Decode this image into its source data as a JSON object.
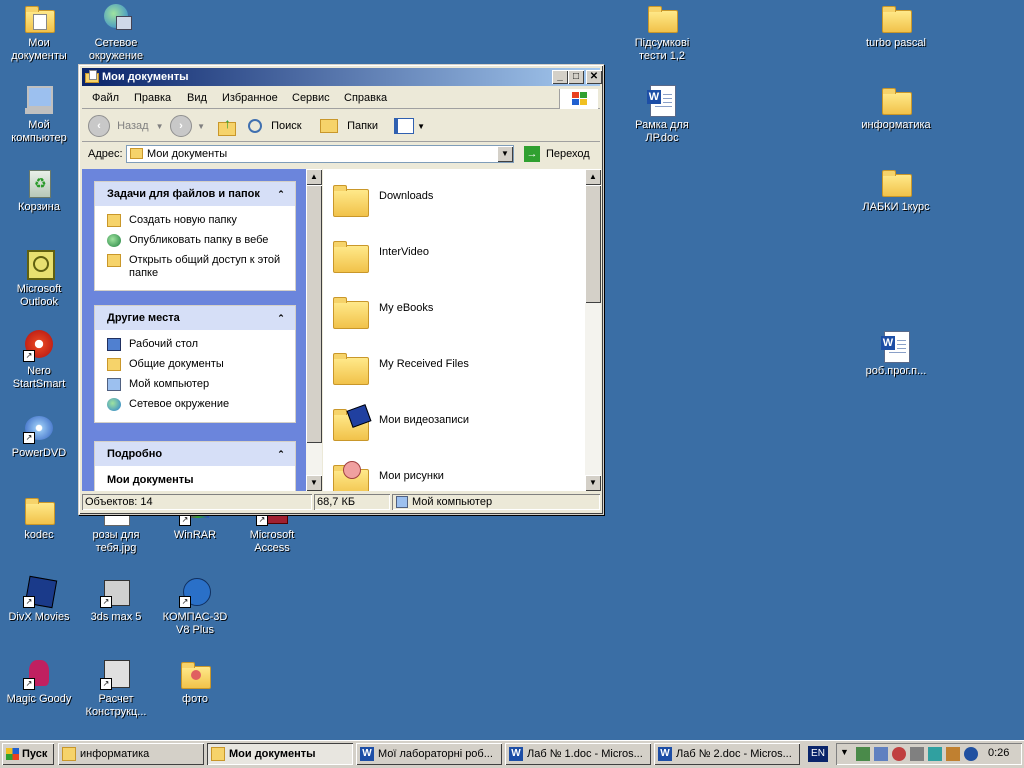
{
  "desktop": {
    "icons": {
      "my_documents": "Мои документы",
      "network": "Сетевое окружение",
      "my_computer": "Мой компьютер",
      "recycle_bin": "Корзина",
      "outlook": "Microsoft Outlook",
      "nero": "Nero StartSmart",
      "powerdvd": "PowerDVD",
      "kodec": "kodec",
      "roses": "розы для тебя.jpg",
      "winrar": "WinRAR",
      "access": "Microsoft Access",
      "divx": "DivX Movies",
      "max": "3ds max 5",
      "kompas": "КОМПАС-3D V8 Plus",
      "magic": "Magic Goody",
      "raschet": "Расчет Конструкц...",
      "foto": "фото",
      "tests": "Підсумкові тести 1,2",
      "ramka": "Рамка для ЛР.doc",
      "turbo": "turbo pascal",
      "informatika": "информатика",
      "labki": "ЛАБКИ 1курс",
      "rob": "роб.прог.п..."
    }
  },
  "window": {
    "title": "Мои документы",
    "menu": [
      "Файл",
      "Правка",
      "Вид",
      "Избранное",
      "Сервис",
      "Справка"
    ],
    "toolbar": {
      "back": "Назад",
      "search": "Поиск",
      "folders": "Папки"
    },
    "address": {
      "label": "Адрес:",
      "value": "Мои документы",
      "go": "Переход"
    },
    "tasks_panel": {
      "title": "Задачи для файлов и папок",
      "links": [
        "Создать новую папку",
        "Опубликовать папку в вебе",
        "Открыть общий доступ к этой папке"
      ]
    },
    "places_panel": {
      "title": "Другие места",
      "links": [
        "Рабочий стол",
        "Общие документы",
        "Мой компьютер",
        "Сетевое окружение"
      ]
    },
    "details_panel": {
      "title": "Подробно",
      "name": "Мои документы"
    },
    "files": [
      "Downloads",
      "InterVideo",
      "My eBooks",
      "My Received Files",
      "Мои видеозаписи",
      "Мои рисунки"
    ],
    "status": {
      "objects": "Объектов: 14",
      "size": "68,7 КБ",
      "location": "Мой компьютер"
    }
  },
  "taskbar": {
    "start": "Пуск",
    "buttons": [
      "информатика",
      "Мои документы",
      "Мої лабораторні роб...",
      "Лаб № 1.doc - Micros...",
      "Лаб № 2.doc - Micros..."
    ],
    "lang": "EN",
    "clock": "0:26"
  },
  "colors": {
    "desktop": "#3a6ea5",
    "title_start": "#0a246a",
    "title_end": "#a6caf0",
    "task_pane": "#6b85dc",
    "panel_header": "#d6dff7"
  }
}
